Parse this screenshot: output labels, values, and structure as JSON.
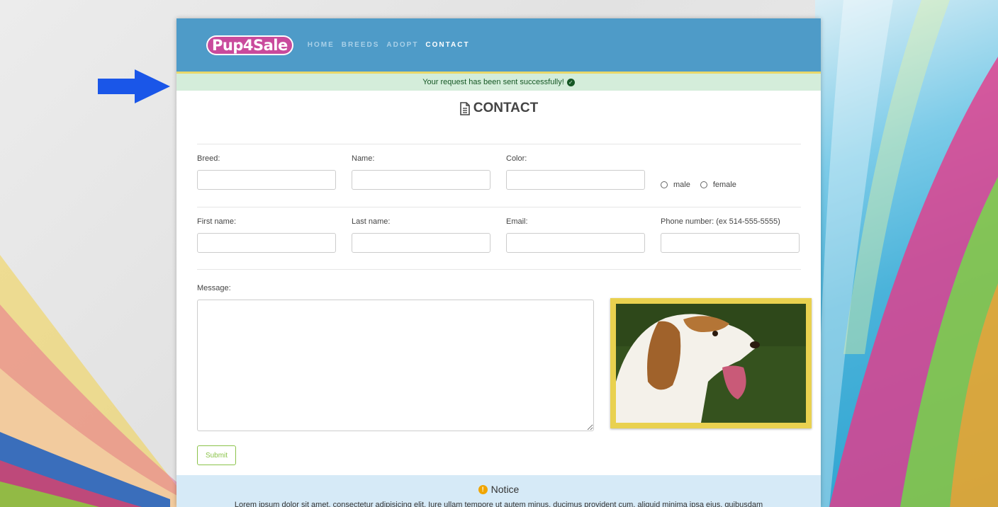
{
  "brand": {
    "logo_text": "Pup4Sale"
  },
  "nav": {
    "items": [
      {
        "label": "HOME",
        "active": false
      },
      {
        "label": "BREEDS",
        "active": false
      },
      {
        "label": "ADOPT",
        "active": false
      },
      {
        "label": "CONTACT",
        "active": true
      }
    ]
  },
  "alert": {
    "text": "Your request has been sent successfully!",
    "icon": "check-circle-icon"
  },
  "page_title": "CONTACT",
  "form": {
    "pet": {
      "breed_label": "Breed:",
      "breed_value": "",
      "name_label": "Name:",
      "name_value": "",
      "color_label": "Color:",
      "color_value": "",
      "gender_options": [
        "male",
        "female"
      ]
    },
    "owner": {
      "first_name_label": "First name:",
      "first_name_value": "",
      "last_name_label": "Last name:",
      "last_name_value": "",
      "email_label": "Email:",
      "email_value": "",
      "phone_label": "Phone number: (ex 514-555-5555)",
      "phone_value": ""
    },
    "message_label": "Message:",
    "message_value": "",
    "submit_label": "Submit"
  },
  "notice": {
    "title": "Notice",
    "text": "Lorem ipsum dolor sit amet, consectetur adipisicing elit. Iure ullam tempore ut autem minus, ducimus provident cum, aliquid minima ipsa eius, quibusdam"
  },
  "colors": {
    "header_bg": "#4e9bc8",
    "success_bg": "#d4edda",
    "success_text": "#155724",
    "notice_bg": "#d6eaf7",
    "photo_frame": "#e9d14f",
    "submit_accent": "#8bc34a",
    "arrow": "#1a56e8"
  }
}
